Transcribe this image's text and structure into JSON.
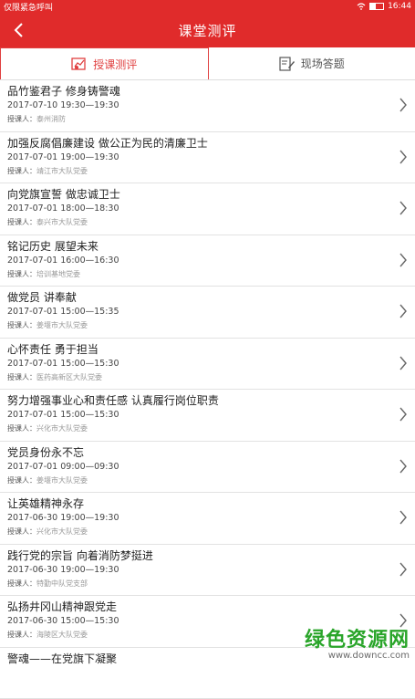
{
  "status_bar": {
    "left_text": "仅限紧急呼叫",
    "time": "16:44"
  },
  "app_bar": {
    "title": "课堂测评"
  },
  "tabs": [
    {
      "label": "授课测评",
      "active": true,
      "icon": "lecture-review-icon"
    },
    {
      "label": "现场答题",
      "active": false,
      "icon": "edit-answer-icon"
    }
  ],
  "lecturer_label": "授课人：",
  "items": [
    {
      "title": "品竹鉴君子  修身铸警魂",
      "time": "2017-07-10 19:30—19:30",
      "lecturer": "泰州消防"
    },
    {
      "title": "加强反腐倡廉建设  做公正为民的清廉卫士",
      "time": "2017-07-01 19:00—19:30",
      "lecturer": "靖江市大队党委"
    },
    {
      "title": "向党旗宣誓  做忠诚卫士",
      "time": "2017-07-01 18:00—18:30",
      "lecturer": "泰兴市大队党委"
    },
    {
      "title": "铭记历史  展望未来",
      "time": "2017-07-01 16:00—16:30",
      "lecturer": "培训基地党委"
    },
    {
      "title": "做党员  讲奉献",
      "time": "2017-07-01 15:00—15:35",
      "lecturer": "姜堰市大队党委"
    },
    {
      "title": "心怀责任  勇于担当",
      "time": "2017-07-01 15:00—15:30",
      "lecturer": "医药高新区大队党委"
    },
    {
      "title": "努力增强事业心和责任感  认真履行岗位职责",
      "time": "2017-07-01 15:00—15:30",
      "lecturer": "兴化市大队党委"
    },
    {
      "title": "党员身份永不忘",
      "time": "2017-07-01 09:00—09:30",
      "lecturer": "姜堰市大队党委"
    },
    {
      "title": "让英雄精神永存",
      "time": "2017-06-30 19:00—19:30",
      "lecturer": "兴化市大队党委"
    },
    {
      "title": "践行党的宗旨  向着消防梦挺进",
      "time": "2017-06-30 19:00—19:30",
      "lecturer": "特勤中队党支部"
    },
    {
      "title": "弘扬井冈山精神跟党走",
      "time": "2017-06-30 15:00—15:30",
      "lecturer": "海陵区大队党委"
    },
    {
      "title": "警魂——在党旗下凝聚",
      "time": "",
      "lecturer": ""
    }
  ],
  "watermark": {
    "line1": "绿色资源网",
    "line2": "www.downcc.com"
  }
}
